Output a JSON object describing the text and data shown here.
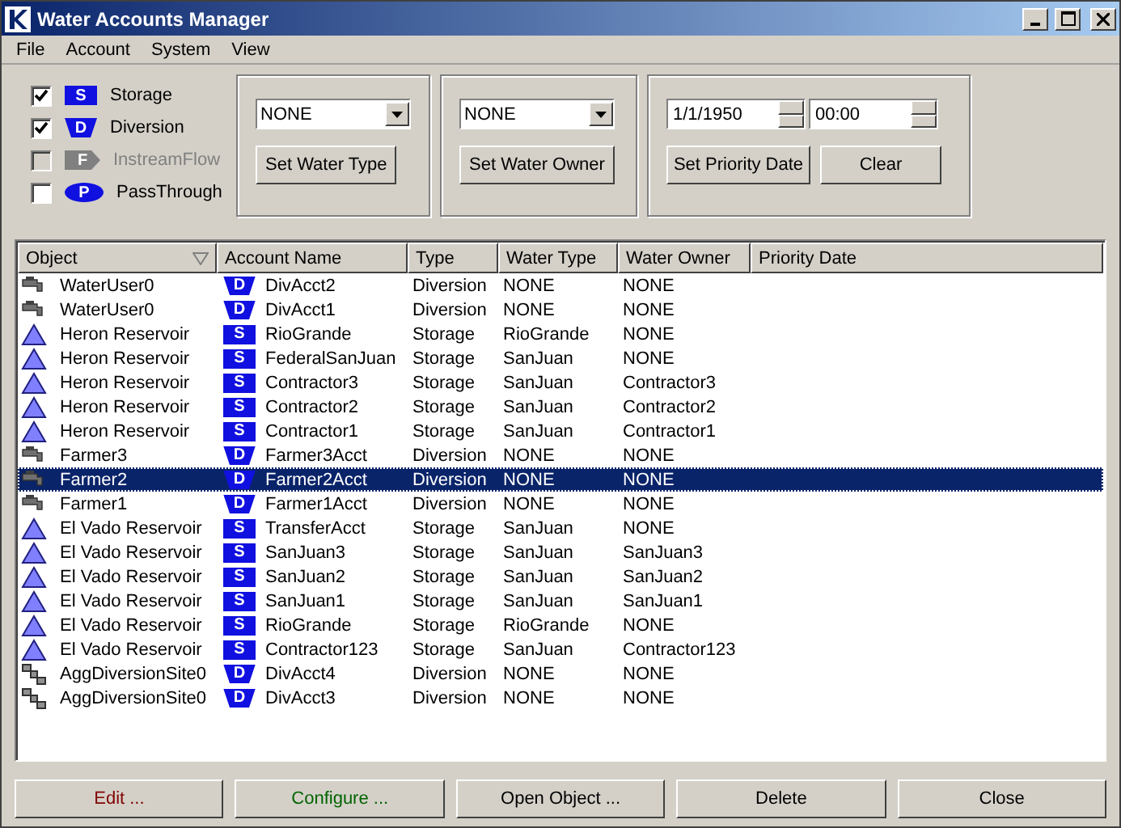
{
  "window": {
    "title": "Water Accounts Manager"
  },
  "menu": [
    "File",
    "Account",
    "System",
    "View"
  ],
  "filters": [
    {
      "kind": "storage",
      "badge": "S",
      "label": "Storage",
      "checked": true,
      "disabled": false
    },
    {
      "kind": "diversion",
      "badge": "D",
      "label": "Diversion",
      "checked": true,
      "disabled": false
    },
    {
      "kind": "instream",
      "badge": "F",
      "label": "InstreamFlow",
      "checked": false,
      "disabled": true
    },
    {
      "kind": "passthrough",
      "badge": "P",
      "label": "PassThrough",
      "checked": false,
      "disabled": false
    }
  ],
  "water_type": {
    "value": "NONE",
    "button": "Set Water Type"
  },
  "water_owner": {
    "value": "NONE",
    "button": "Set Water Owner"
  },
  "priority": {
    "date": "1/1/1950",
    "time": "00:00",
    "set_button": "Set Priority Date",
    "clear_button": "Clear"
  },
  "table": {
    "columns": [
      "Object",
      "Account Name",
      "Type",
      "Water Type",
      "Water Owner",
      "Priority Date"
    ],
    "rows": [
      {
        "object": {
          "kind": "user",
          "name": "WaterUser0"
        },
        "account": {
          "kind": "diversion",
          "badge": "D",
          "name": "DivAcct2"
        },
        "type": "Diversion",
        "water_type": "NONE",
        "water_owner": "NONE",
        "selected": false
      },
      {
        "object": {
          "kind": "user",
          "name": "WaterUser0"
        },
        "account": {
          "kind": "diversion",
          "badge": "D",
          "name": "DivAcct1"
        },
        "type": "Diversion",
        "water_type": "NONE",
        "water_owner": "NONE",
        "selected": false
      },
      {
        "object": {
          "kind": "reservoir",
          "name": "Heron Reservoir"
        },
        "account": {
          "kind": "storage",
          "badge": "S",
          "name": "RioGrande"
        },
        "type": "Storage",
        "water_type": "RioGrande",
        "water_owner": "NONE",
        "selected": false
      },
      {
        "object": {
          "kind": "reservoir",
          "name": "Heron Reservoir"
        },
        "account": {
          "kind": "storage",
          "badge": "S",
          "name": "FederalSanJuan"
        },
        "type": "Storage",
        "water_type": "SanJuan",
        "water_owner": "NONE",
        "selected": false
      },
      {
        "object": {
          "kind": "reservoir",
          "name": "Heron Reservoir"
        },
        "account": {
          "kind": "storage",
          "badge": "S",
          "name": "Contractor3"
        },
        "type": "Storage",
        "water_type": "SanJuan",
        "water_owner": "Contractor3",
        "selected": false
      },
      {
        "object": {
          "kind": "reservoir",
          "name": "Heron Reservoir"
        },
        "account": {
          "kind": "storage",
          "badge": "S",
          "name": "Contractor2"
        },
        "type": "Storage",
        "water_type": "SanJuan",
        "water_owner": "Contractor2",
        "selected": false
      },
      {
        "object": {
          "kind": "reservoir",
          "name": "Heron Reservoir"
        },
        "account": {
          "kind": "storage",
          "badge": "S",
          "name": "Contractor1"
        },
        "type": "Storage",
        "water_type": "SanJuan",
        "water_owner": "Contractor1",
        "selected": false
      },
      {
        "object": {
          "kind": "user",
          "name": "Farmer3"
        },
        "account": {
          "kind": "diversion",
          "badge": "D",
          "name": "Farmer3Acct"
        },
        "type": "Diversion",
        "water_type": "NONE",
        "water_owner": "NONE",
        "selected": false
      },
      {
        "object": {
          "kind": "user",
          "name": "Farmer2"
        },
        "account": {
          "kind": "diversion",
          "badge": "D",
          "name": "Farmer2Acct"
        },
        "type": "Diversion",
        "water_type": "NONE",
        "water_owner": "NONE",
        "selected": true
      },
      {
        "object": {
          "kind": "user",
          "name": "Farmer1"
        },
        "account": {
          "kind": "diversion",
          "badge": "D",
          "name": "Farmer1Acct"
        },
        "type": "Diversion",
        "water_type": "NONE",
        "water_owner": "NONE",
        "selected": false
      },
      {
        "object": {
          "kind": "reservoir",
          "name": "El Vado Reservoir"
        },
        "account": {
          "kind": "storage",
          "badge": "S",
          "name": "TransferAcct"
        },
        "type": "Storage",
        "water_type": "SanJuan",
        "water_owner": "NONE",
        "selected": false
      },
      {
        "object": {
          "kind": "reservoir",
          "name": "El Vado Reservoir"
        },
        "account": {
          "kind": "storage",
          "badge": "S",
          "name": "SanJuan3"
        },
        "type": "Storage",
        "water_type": "SanJuan",
        "water_owner": "SanJuan3",
        "selected": false
      },
      {
        "object": {
          "kind": "reservoir",
          "name": "El Vado Reservoir"
        },
        "account": {
          "kind": "storage",
          "badge": "S",
          "name": "SanJuan2"
        },
        "type": "Storage",
        "water_type": "SanJuan",
        "water_owner": "SanJuan2",
        "selected": false
      },
      {
        "object": {
          "kind": "reservoir",
          "name": "El Vado Reservoir"
        },
        "account": {
          "kind": "storage",
          "badge": "S",
          "name": "SanJuan1"
        },
        "type": "Storage",
        "water_type": "SanJuan",
        "water_owner": "SanJuan1",
        "selected": false
      },
      {
        "object": {
          "kind": "reservoir",
          "name": "El Vado Reservoir"
        },
        "account": {
          "kind": "storage",
          "badge": "S",
          "name": "RioGrande"
        },
        "type": "Storage",
        "water_type": "RioGrande",
        "water_owner": "NONE",
        "selected": false
      },
      {
        "object": {
          "kind": "reservoir",
          "name": "El Vado Reservoir"
        },
        "account": {
          "kind": "storage",
          "badge": "S",
          "name": "Contractor123"
        },
        "type": "Storage",
        "water_type": "SanJuan",
        "water_owner": "Contractor123",
        "selected": false
      },
      {
        "object": {
          "kind": "aggregate",
          "name": "AggDiversionSite0"
        },
        "account": {
          "kind": "diversion",
          "badge": "D",
          "name": "DivAcct4"
        },
        "type": "Diversion",
        "water_type": "NONE",
        "water_owner": "NONE",
        "selected": false
      },
      {
        "object": {
          "kind": "aggregate",
          "name": "AggDiversionSite0"
        },
        "account": {
          "kind": "diversion",
          "badge": "D",
          "name": "DivAcct3"
        },
        "type": "Diversion",
        "water_type": "NONE",
        "water_owner": "NONE",
        "selected": false
      }
    ]
  },
  "buttons": [
    {
      "label": "Edit ...",
      "color": "#800000"
    },
    {
      "label": "Configure ...",
      "color": "#006400"
    },
    {
      "label": "Open Object ...",
      "color": "#000000"
    },
    {
      "label": "Delete",
      "color": "#000000"
    },
    {
      "label": "Close",
      "color": "#000000"
    }
  ]
}
